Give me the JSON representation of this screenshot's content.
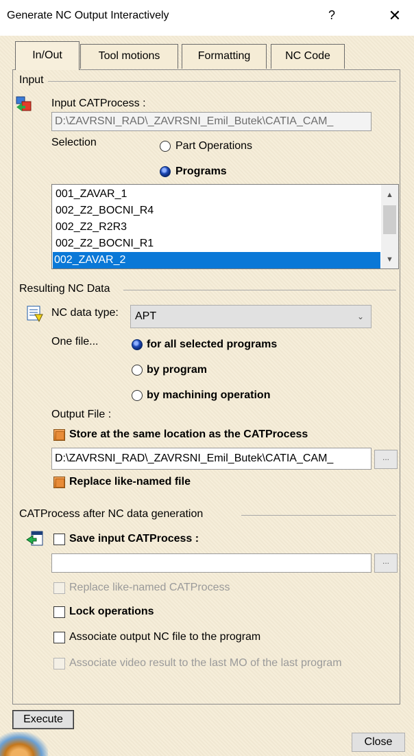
{
  "window": {
    "title": "Generate NC Output Interactively",
    "help_label": "?",
    "close_label": "✕"
  },
  "tabs": [
    {
      "label": "In/Out"
    },
    {
      "label": "Tool motions"
    },
    {
      "label": "Formatting"
    },
    {
      "label": "NC Code"
    }
  ],
  "input": {
    "group_label": "Input",
    "catprocess_label": "Input CATProcess :",
    "catprocess_path": "D:\\ZAVRSNI_RAD\\_ZAVRSNI_Emil_Butek\\CATIA_CAM_",
    "selection_label": "Selection",
    "part_operations_label": "Part Operations",
    "programs_label": "Programs",
    "programs_list": [
      "001_ZAVAR_1",
      "002_Z2_BOCNI_R4",
      "002_Z2_R2R3",
      "002_Z2_BOCNI_R1",
      "002_ZAVAR_2"
    ],
    "selected_program": "002_ZAVAR_2"
  },
  "result": {
    "group_label": "Resulting NC Data",
    "nc_type_label": "NC data type:",
    "nc_type_value": "APT",
    "one_file_label": "One file...",
    "opt_all": "for all selected programs",
    "opt_by_program": "by program",
    "opt_by_mo": "by machining operation",
    "output_file_label": "Output File :",
    "store_label": "Store at the same location as the CATProcess",
    "output_path": "D:\\ZAVRSNI_RAD\\_ZAVRSNI_Emil_Butek\\CATIA_CAM_",
    "browse_label": "...",
    "replace_label": "Replace like-named file"
  },
  "after": {
    "group_label": "CATProcess after NC data generation",
    "save_label": "Save input CATProcess :",
    "save_path": "",
    "browse_label": "...",
    "replace_catprocess_label": "Replace like-named CATProcess",
    "lock_label": "Lock operations",
    "associate_label": "Associate output NC file to the program",
    "associate_video_label": "Associate video result to the last MO of the last program"
  },
  "buttons": {
    "execute": "Execute",
    "close": "Close"
  },
  "colors": {
    "accent": "#0a78d7",
    "background": "#f5ecd6",
    "check_on": "#e88c38"
  }
}
